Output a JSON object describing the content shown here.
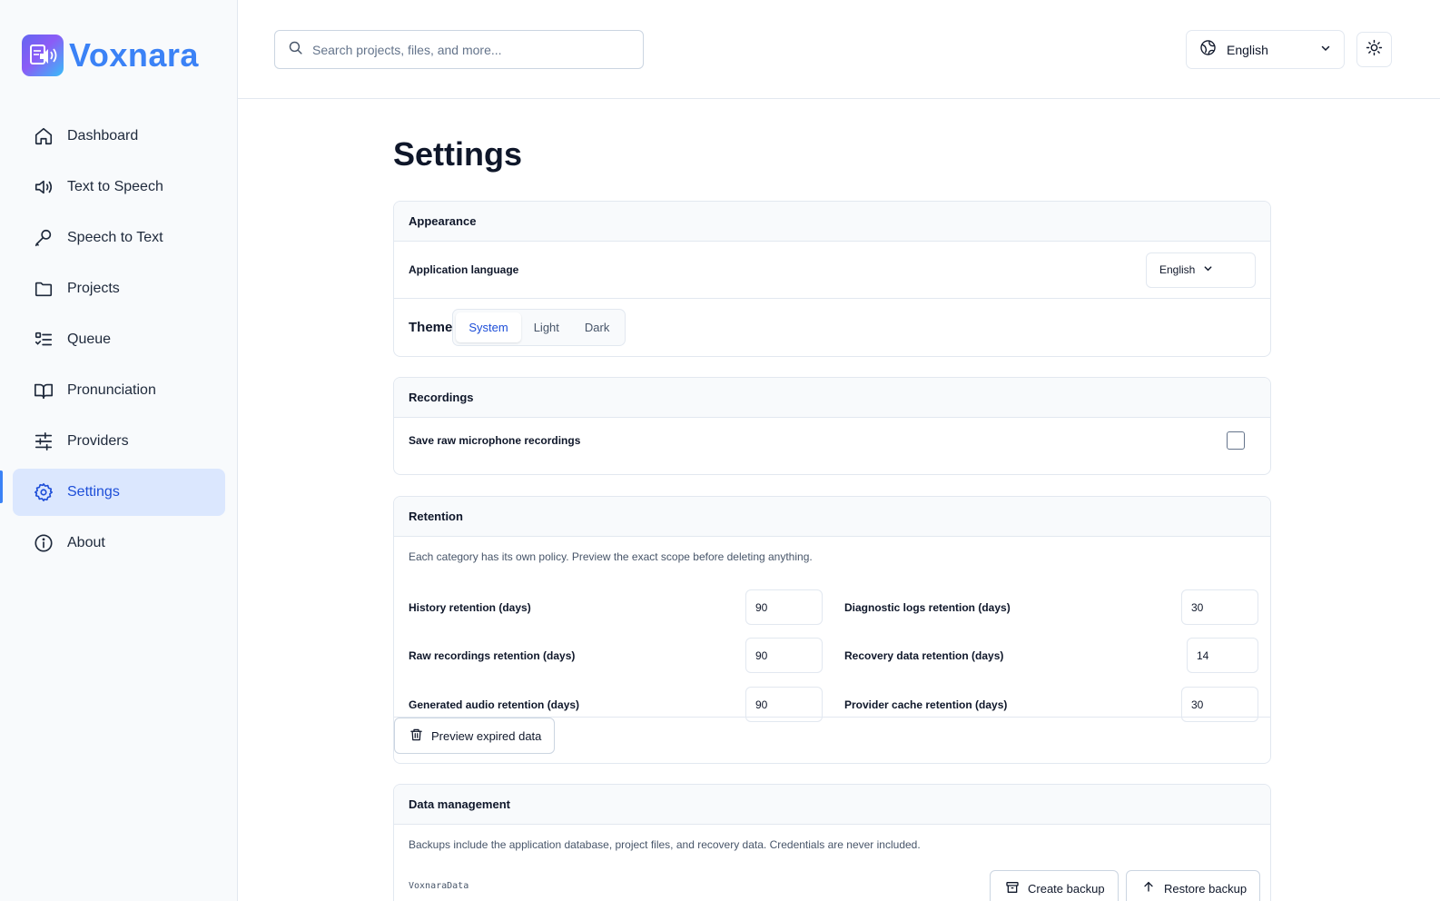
{
  "app": {
    "name": "Voxnara"
  },
  "sidebar": {
    "items": [
      {
        "label": "Dashboard",
        "icon": "home-icon",
        "active": false
      },
      {
        "label": "Text to Speech",
        "icon": "speaker-icon",
        "active": false
      },
      {
        "label": "Speech to Text",
        "icon": "microphone-icon",
        "active": false
      },
      {
        "label": "Projects",
        "icon": "folder-icon",
        "active": false
      },
      {
        "label": "Queue",
        "icon": "list-checks-icon",
        "active": false
      },
      {
        "label": "Pronunciation",
        "icon": "book-icon",
        "active": false
      },
      {
        "label": "Providers",
        "icon": "sliders-icon",
        "active": false
      },
      {
        "label": "Settings",
        "icon": "gear-icon",
        "active": true
      },
      {
        "label": "About",
        "icon": "info-icon",
        "active": false
      }
    ]
  },
  "header": {
    "search_placeholder": "Search projects, files, and more...",
    "language": "English"
  },
  "page": {
    "title": "Settings"
  },
  "appearance": {
    "title": "Appearance",
    "language_label": "Application language",
    "language_value": "English",
    "theme_label": "Theme",
    "theme_options": [
      "System",
      "Light",
      "Dark"
    ],
    "theme_selected": "System"
  },
  "recordings": {
    "title": "Recordings",
    "save_raw_label": "Save raw microphone recordings",
    "save_raw_checked": false
  },
  "retention": {
    "title": "Retention",
    "description": "Each category has its own policy. Preview the exact scope before deleting anything.",
    "fields": {
      "history": {
        "label": "History retention (days)",
        "value": "90"
      },
      "raw_recordings": {
        "label": "Raw recordings retention (days)",
        "value": "90"
      },
      "generated_audio": {
        "label": "Generated audio retention (days)",
        "value": "90"
      },
      "diagnostic_logs": {
        "label": "Diagnostic logs retention (days)",
        "value": "30"
      },
      "recovery_data": {
        "label": "Recovery data retention (days)",
        "value": "14"
      },
      "provider_cache": {
        "label": "Provider cache retention (days)",
        "value": "30"
      }
    },
    "preview_button": "Preview expired data"
  },
  "data_management": {
    "title": "Data management",
    "description": "Backups include the application database, project files, and recovery data. Credentials are never included.",
    "data_dir": "VoxnaraData",
    "create_backup": "Create backup",
    "restore_backup": "Restore backup"
  },
  "colors": {
    "accent": "#3b82f6",
    "active_bg": "#dbe7fe",
    "border": "#e2e8f0"
  }
}
